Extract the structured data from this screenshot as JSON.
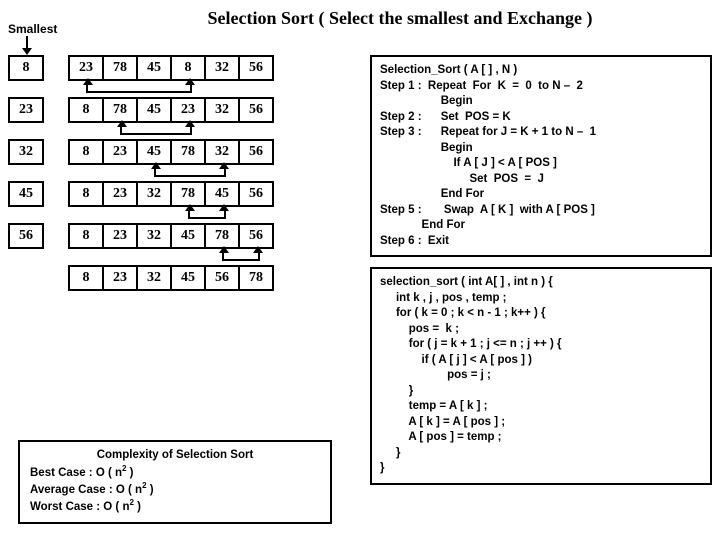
{
  "title": "Selection Sort ( Select the smallest and Exchange )",
  "smallest_label": "Smallest",
  "rows": [
    {
      "lead": "8",
      "arr": [
        "23",
        "78",
        "45",
        "8",
        "32",
        "56"
      ]
    },
    {
      "lead": "23",
      "arr": [
        "8",
        "78",
        "45",
        "23",
        "32",
        "56"
      ]
    },
    {
      "lead": "32",
      "arr": [
        "8",
        "23",
        "45",
        "78",
        "32",
        "56"
      ]
    },
    {
      "lead": "45",
      "arr": [
        "8",
        "23",
        "32",
        "78",
        "45",
        "56"
      ]
    },
    {
      "lead": "56",
      "arr": [
        "8",
        "23",
        "32",
        "45",
        "78",
        "56"
      ]
    }
  ],
  "final_row": [
    "8",
    "23",
    "32",
    "45",
    "56",
    "78"
  ],
  "pseudo": {
    "l0": "Selection_Sort ( A [ ] , N )",
    "l1": "Step 1 :  Repeat  For  K  =  0  to N –  2",
    "l2": "                   Begin",
    "l3": "Step 2 :      Set  POS = K",
    "l4": "Step 3 :      Repeat for J = K + 1 to N –  1",
    "l5": "                   Begin",
    "l6": "                       If A [ J ] < A [ POS ]",
    "l7": "                            Set  POS  =  J",
    "l8": "                   End For",
    "l9": "Step 5 :       Swap  A [ K ]  with A [ POS ]",
    "l10": "             End For",
    "l11": "Step 6 :  Exit"
  },
  "code": {
    "l0": "selection_sort ( int A[ ] , int n ) {",
    "l1": "     int k , j , pos , temp ;",
    "l2": "     for ( k = 0 ; k < n - 1 ; k++ ) {",
    "l3": "         pos =  k ;",
    "l4": "         for ( j = k + 1 ; j <= n ; j ++ ) {",
    "l5": "             if ( A [ j ] < A [ pos ] )",
    "l6": "                     pos = j ;",
    "l7": "         }",
    "l8": "         temp = A [ k ] ;",
    "l9": "         A [ k ] = A [ pos ] ;",
    "l10": "         A [ pos ] = temp ;",
    "l11": "     }",
    "l12": "}"
  },
  "complexity": {
    "title": "Complexity of Selection Sort",
    "best": "Best Case :  O ( n",
    "avg": "Average Case :  O ( n",
    "worst": "Worst Case :  O ( n",
    "exp": "2",
    "close": " )"
  },
  "chart_data": {
    "type": "table",
    "title": "Selection Sort passes",
    "columns": [
      "smallest",
      "a0",
      "a1",
      "a2",
      "a3",
      "a4",
      "a5"
    ],
    "rows": [
      [
        "8",
        23,
        78,
        45,
        8,
        32,
        56
      ],
      [
        "23",
        8,
        78,
        45,
        23,
        32,
        56
      ],
      [
        "32",
        8,
        23,
        45,
        78,
        32,
        56
      ],
      [
        "45",
        8,
        23,
        32,
        78,
        45,
        56
      ],
      [
        "56",
        8,
        23,
        32,
        45,
        78,
        56
      ],
      [
        "",
        8,
        23,
        32,
        45,
        56,
        78
      ]
    ]
  }
}
